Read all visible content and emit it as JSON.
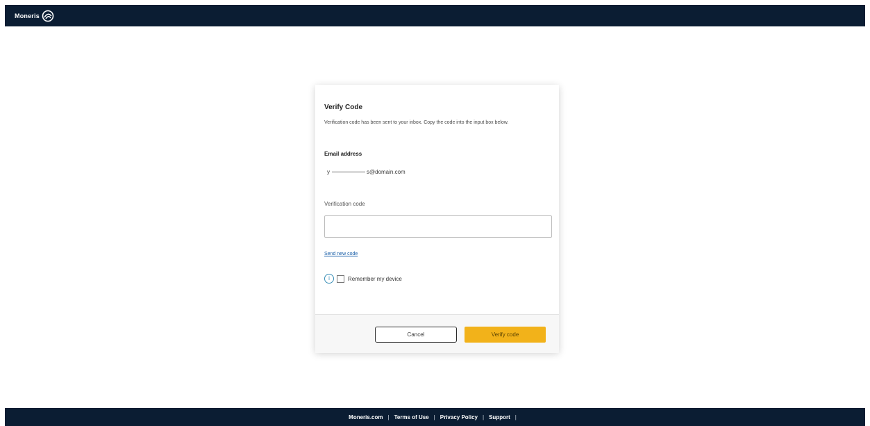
{
  "header": {
    "brand": "Moneris"
  },
  "card": {
    "title": "Verify Code",
    "description": "Verification code has been sent to your inbox. Copy the code into the input box below.",
    "email_label": "Email address",
    "email_prefix": "y",
    "email_suffix": "s@domain.com",
    "code_label": "Verification code",
    "code_value": "",
    "send_new_code": "Send new code",
    "remember_label": "Remember my device",
    "remember_checked": false
  },
  "buttons": {
    "cancel": "Cancel",
    "verify": "Verify code"
  },
  "footer": {
    "links": [
      "Moneris.com",
      "Terms of Use",
      "Privacy Policy",
      "Support"
    ]
  },
  "colors": {
    "nav_bg": "#0b1d33",
    "accent": "#f2b21a",
    "link": "#1a5fa8"
  },
  "icons": {
    "brand": "moneris-logo-icon",
    "info": "info-icon"
  }
}
